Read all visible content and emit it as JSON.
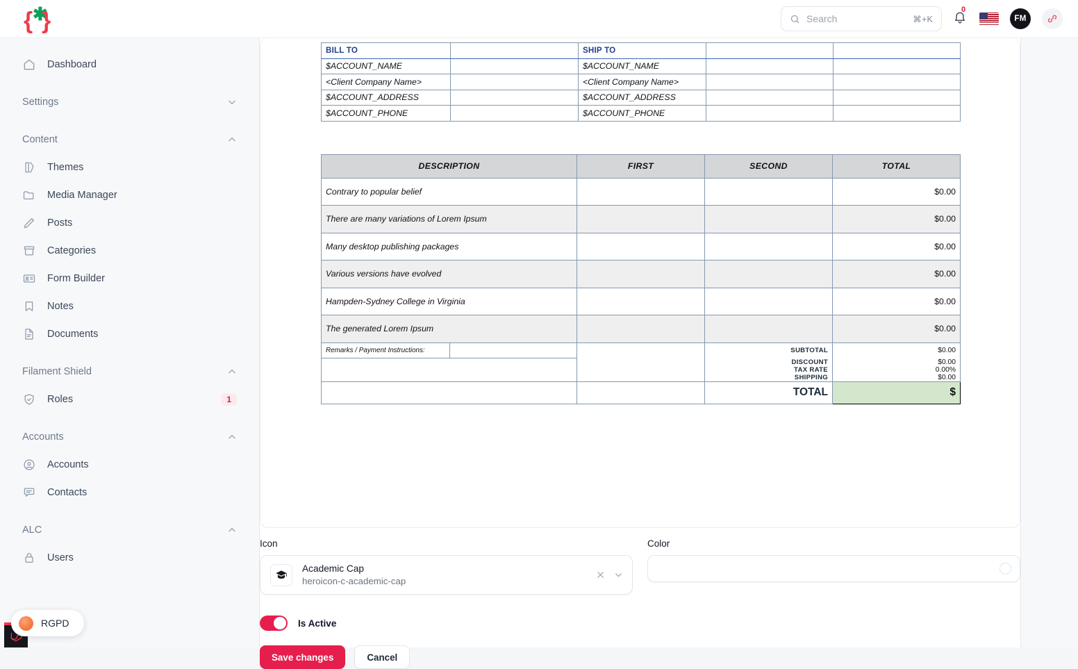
{
  "topbar": {
    "search": {
      "placeholder": "Search",
      "shortcut": "⌘+K"
    },
    "notifications_count": "0",
    "avatar_initials": "FM"
  },
  "sidebar": {
    "dashboard": {
      "label": "Dashboard",
      "icon": "home-icon"
    },
    "groups": [
      {
        "title": "Settings",
        "collapsed": true,
        "items": []
      },
      {
        "title": "Content",
        "collapsed": false,
        "items": [
          {
            "label": "Themes",
            "icon": "theme-icon"
          },
          {
            "label": "Media Manager",
            "icon": "folder-icon"
          },
          {
            "label": "Posts",
            "icon": "pencil-icon"
          },
          {
            "label": "Categories",
            "icon": "archive-icon"
          },
          {
            "label": "Form Builder",
            "icon": "id-card-icon"
          },
          {
            "label": "Notes",
            "icon": "bookmark-icon"
          },
          {
            "label": "Documents",
            "icon": "document-icon"
          }
        ]
      },
      {
        "title": "Filament Shield",
        "collapsed": false,
        "items": [
          {
            "label": "Roles",
            "icon": "shield-check-icon",
            "badge": "1"
          }
        ]
      },
      {
        "title": "Accounts",
        "collapsed": false,
        "items": [
          {
            "label": "Accounts",
            "icon": "user-circle-icon"
          },
          {
            "label": "Contacts",
            "icon": "chat-bubble-icon"
          }
        ]
      },
      {
        "title": "ALC",
        "collapsed": false,
        "items": [
          {
            "label": "Users",
            "icon": "lock-icon"
          }
        ]
      }
    ],
    "cookie_badge": {
      "label": "RGPD"
    }
  },
  "invoice": {
    "bill_ship": {
      "headers": [
        "BILL TO",
        "SHIP TO"
      ],
      "rows": [
        {
          "bill": "$ACCOUNT_NAME",
          "ship": "$ACCOUNT_NAME"
        },
        {
          "bill": "<Client Company Name>",
          "ship": "<Client Company Name>"
        },
        {
          "bill": "$ACCOUNT_ADDRESS",
          "ship": "$ACCOUNT_ADDRESS"
        },
        {
          "bill": "$ACCOUNT_PHONE",
          "ship": "$ACCOUNT_PHONE"
        }
      ]
    },
    "items": {
      "columns": [
        "DESCRIPTION",
        "FIRST",
        "SECOND",
        "TOTAL"
      ],
      "rows": [
        {
          "description": "Contrary to popular belief",
          "first": "",
          "second": "",
          "total": "$0.00"
        },
        {
          "description": "There are many variations of Lorem Ipsum",
          "first": "",
          "second": "",
          "total": "$0.00"
        },
        {
          "description": "Many desktop publishing packages",
          "first": "",
          "second": "",
          "total": "$0.00"
        },
        {
          "description": "Various versions have evolved",
          "first": "",
          "second": "",
          "total": "$0.00"
        },
        {
          "description": "Hampden-Sydney College in Virginia",
          "first": "",
          "second": "",
          "total": "$0.00"
        },
        {
          "description": "The generated Lorem Ipsum",
          "first": "",
          "second": "",
          "total": "$0.00"
        }
      ]
    },
    "remarks_label": "Remarks / Payment Instructions:",
    "summary": [
      {
        "label": "SUBTOTAL",
        "value": "$0.00"
      },
      {
        "label": "DISCOUNT",
        "value": "$0.00"
      },
      {
        "label": "TAX RATE",
        "value": "0.00%"
      },
      {
        "label": "SHIPPING",
        "value": "$0.00"
      }
    ],
    "total": {
      "label": "TOTAL",
      "value": "$"
    }
  },
  "form": {
    "icon_field": {
      "label": "Icon",
      "selected_title": "Academic Cap",
      "selected_key": "heroicon-c-academic-cap"
    },
    "color_field": {
      "label": "Color",
      "value": ""
    },
    "is_active": {
      "label": "Is Active",
      "on": true
    },
    "save_label": "Save changes",
    "cancel_label": "Cancel"
  },
  "colors": {
    "accent": "#e61e4d",
    "brand_green": "#0ea05a",
    "total_cell_bg": "#d4e7cc",
    "table_border": "#8399b0",
    "header_bg": "#d4d6d8"
  }
}
